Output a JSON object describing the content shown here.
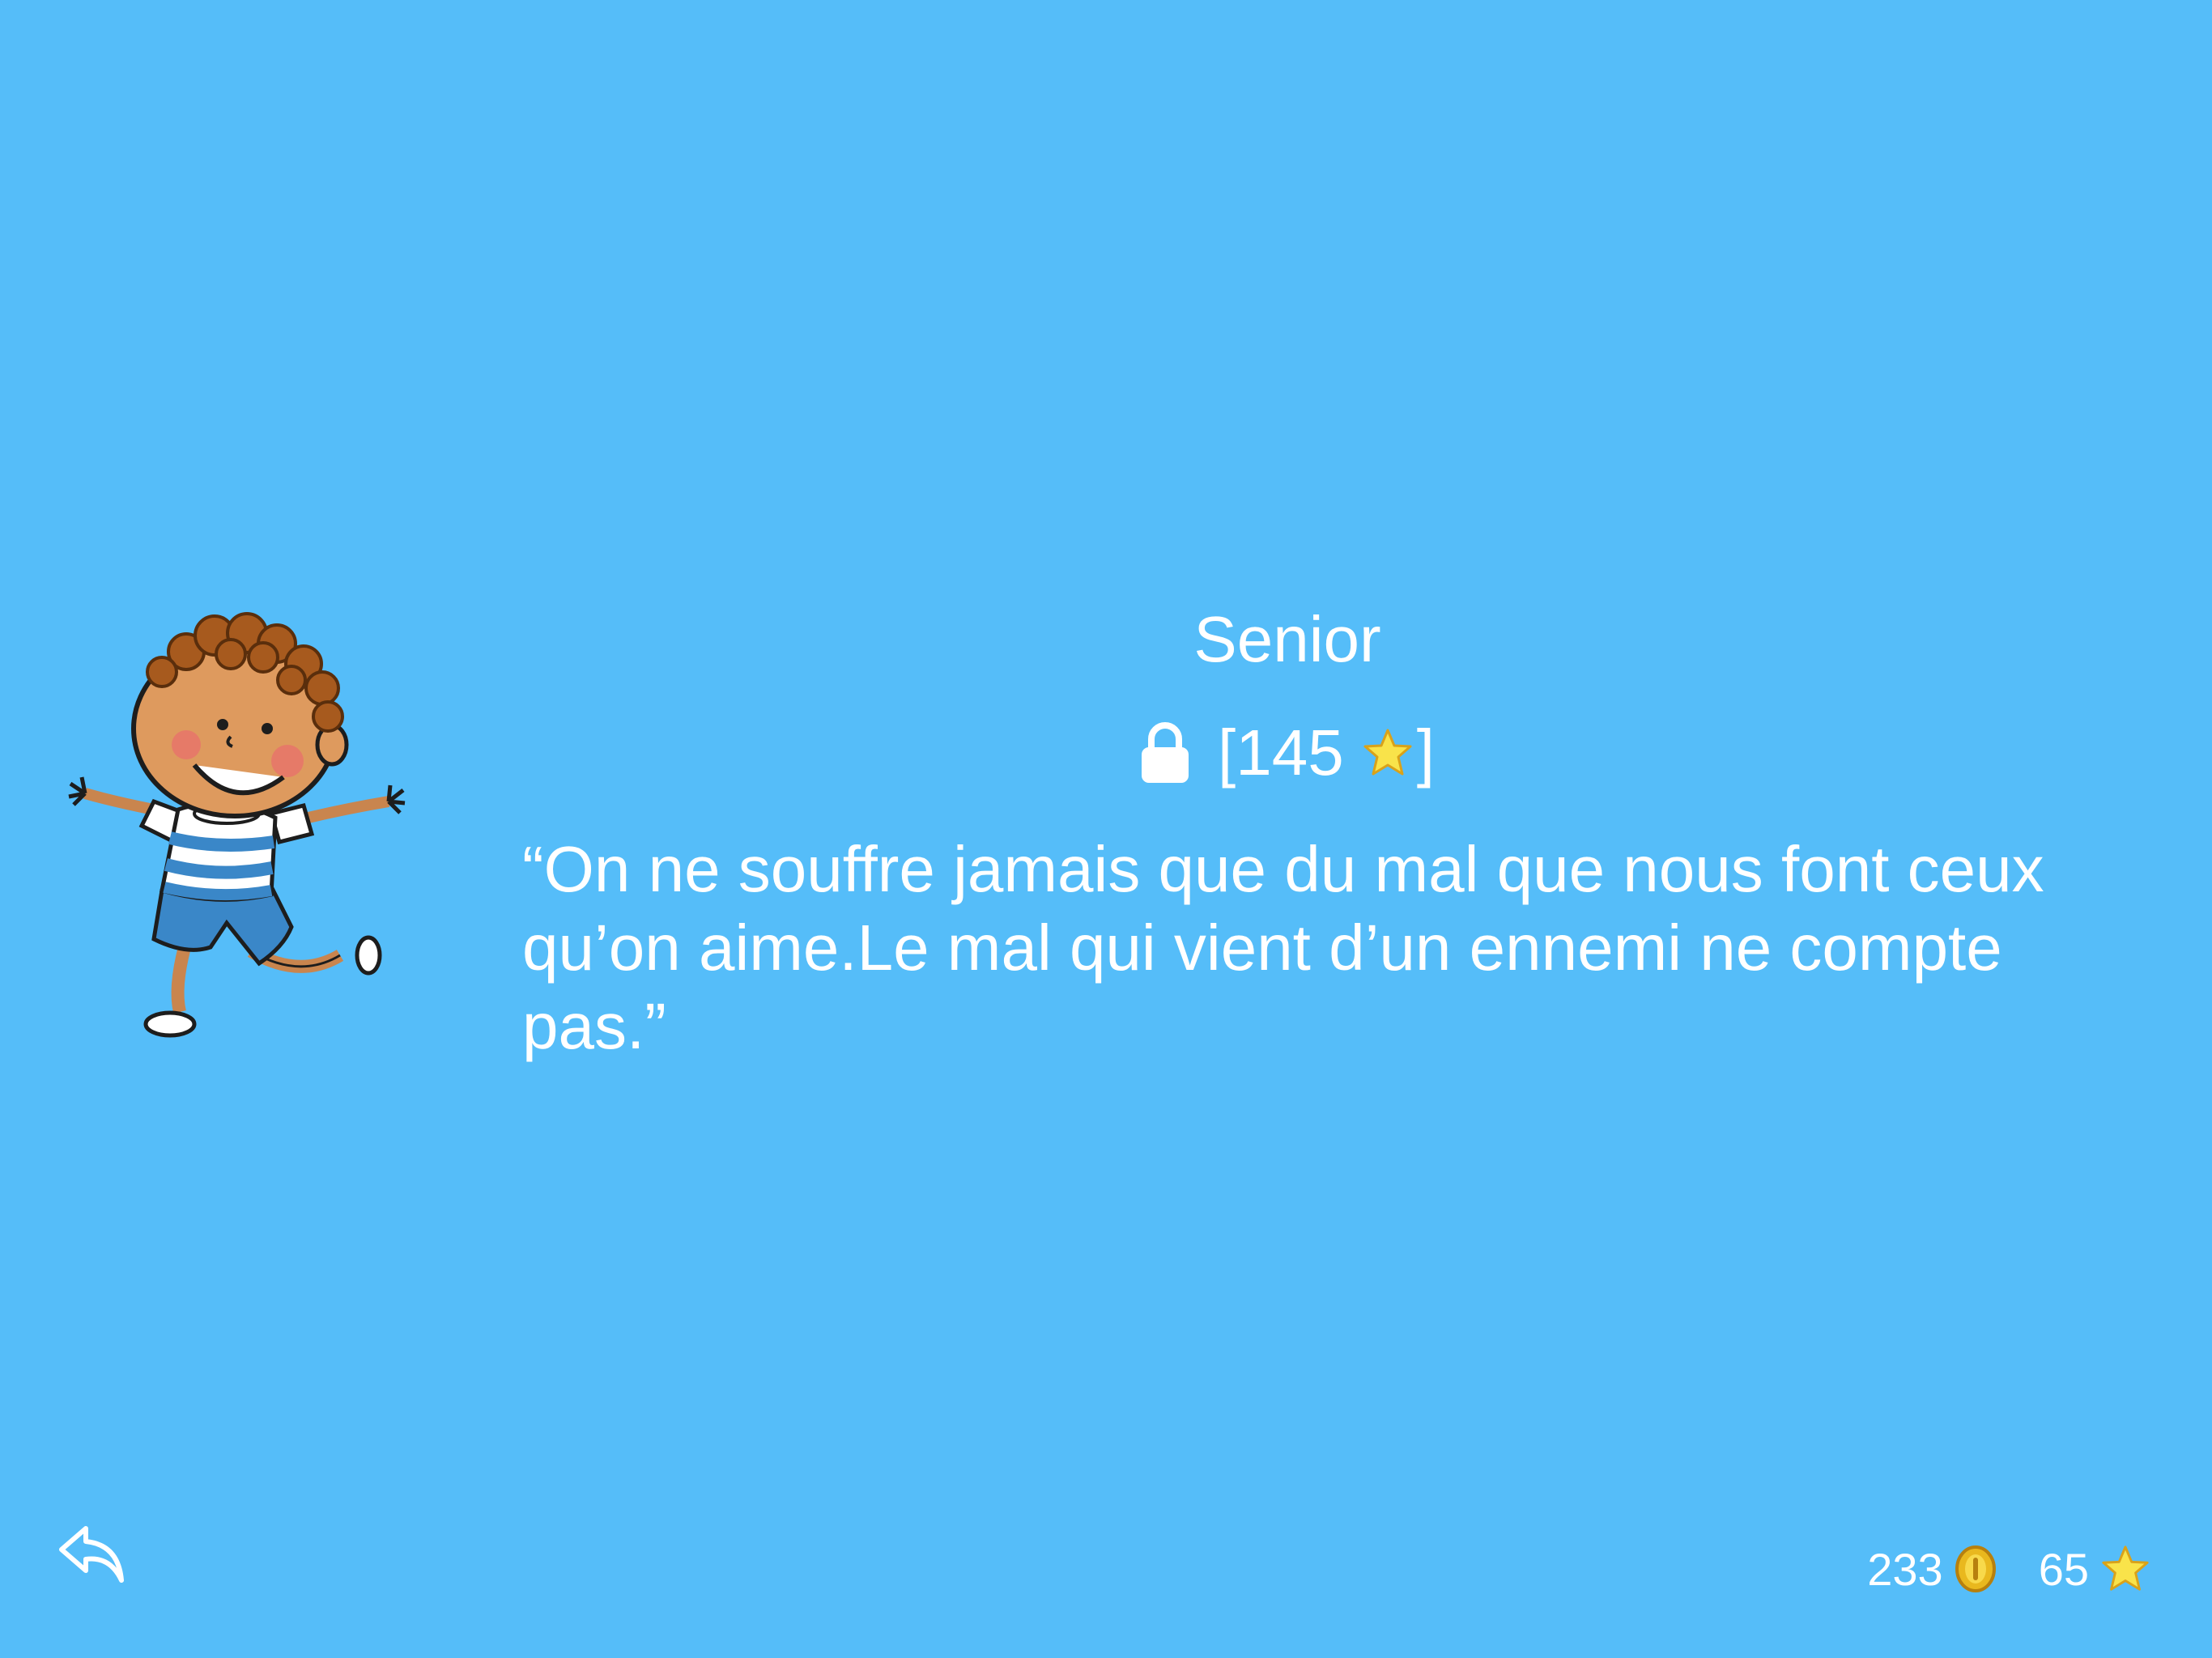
{
  "level": {
    "title": "Senior",
    "open_bracket": "[",
    "required_stars": "145",
    "close_bracket": "]",
    "quote": "“On ne souffre jamais que du mal que nous font ceux qu’on aime.Le mal qui vient d’un ennemi ne compte pas.”"
  },
  "footer": {
    "coins": "233",
    "stars": "65"
  },
  "icons": {
    "back": "back-arrow-icon",
    "lock": "lock-icon",
    "coin": "coin-icon",
    "star": "star-icon",
    "character": "boy-character-illustration"
  },
  "colors": {
    "background": "#55BDF9",
    "text": "#FFFFFF",
    "star": "#F9E34A",
    "coin": "#E9B81E"
  }
}
